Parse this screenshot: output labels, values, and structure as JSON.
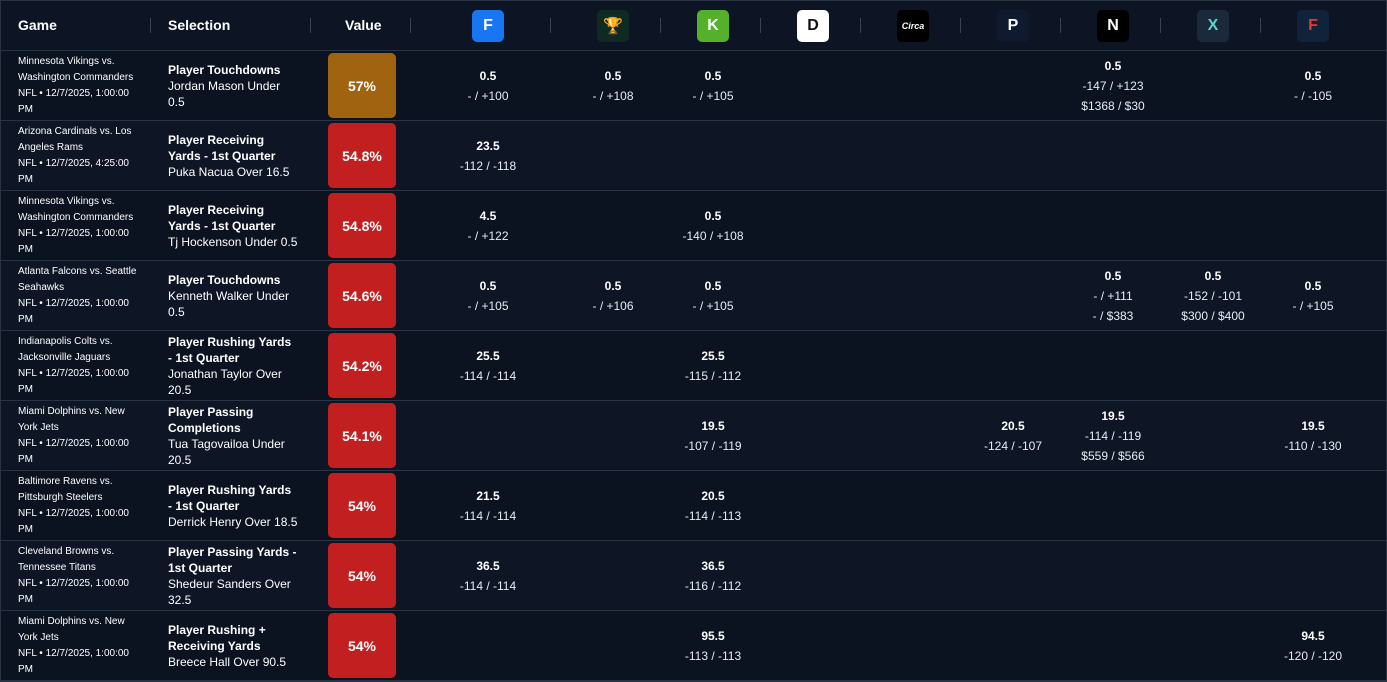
{
  "columns": {
    "game": "Game",
    "selection": "Selection",
    "value": "Value"
  },
  "books": [
    {
      "icon": "fanduel-icon",
      "glyph": "F",
      "bg": "#1876f2",
      "fg": "#ffffff"
    },
    {
      "icon": "trophy-icon",
      "glyph": "🏆",
      "bg": "#0f2a22",
      "fg": "#d9c58a"
    },
    {
      "icon": "draftkings-icon",
      "glyph": "K",
      "bg": "#53b12b",
      "fg": "#ffffff"
    },
    {
      "icon": "dabble-icon",
      "glyph": "D",
      "bg": "#ffffff",
      "fg": "#111111"
    },
    {
      "icon": "circa-icon",
      "glyph": "Circa",
      "bg": "#000000",
      "fg": "#ffffff"
    },
    {
      "icon": "prizepicks-icon",
      "glyph": "P",
      "bg": "#0f1a2e",
      "fg": "#ffffff"
    },
    {
      "icon": "novig-icon",
      "glyph": "N",
      "bg": "#000000",
      "fg": "#ffffff"
    },
    {
      "icon": "prophetx-icon",
      "glyph": "X",
      "bg": "#1b2a3a",
      "fg": "#5fd3c9"
    },
    {
      "icon": "fliff-icon",
      "glyph": "F",
      "bg": "#11233a",
      "fg": "#e53935"
    }
  ],
  "colors": {
    "value_high": "#a06410",
    "value_mid": "#c22020"
  },
  "rows": [
    {
      "game": "Minnesota Vikings vs. Washington Commanders",
      "meta": "NFL • 12/7/2025, 1:00:00 PM",
      "market": "Player Touchdowns",
      "pick": "Jordan Mason Under 0.5",
      "value": "57%",
      "tone": "high",
      "odds": [
        {
          "book": 0,
          "line": "0.5",
          "price": "- / +100"
        },
        {
          "book": 1,
          "line": "0.5",
          "price": "- / +108"
        },
        {
          "book": 2,
          "line": "0.5",
          "price": "- / +105"
        },
        {
          "book": 6,
          "line": "0.5",
          "price": "-147 / +123",
          "limit": "$1368 / $30"
        },
        {
          "book": 8,
          "line": "0.5",
          "price": "- / -105"
        }
      ]
    },
    {
      "game": "Arizona Cardinals vs. Los Angeles Rams",
      "meta": "NFL • 12/7/2025, 4:25:00 PM",
      "market": "Player Receiving Yards - 1st Quarter",
      "pick": "Puka Nacua Over 16.5",
      "value": "54.8%",
      "tone": "mid",
      "odds": [
        {
          "book": 0,
          "line": "23.5",
          "price": "-112 / -118"
        }
      ]
    },
    {
      "game": "Minnesota Vikings vs. Washington Commanders",
      "meta": "NFL • 12/7/2025, 1:00:00 PM",
      "market": "Player Receiving Yards - 1st Quarter",
      "pick": "Tj Hockenson Under 0.5",
      "value": "54.8%",
      "tone": "mid",
      "odds": [
        {
          "book": 0,
          "line": "4.5",
          "price": "- / +122"
        },
        {
          "book": 2,
          "line": "0.5",
          "price": "-140 / +108"
        }
      ]
    },
    {
      "game": "Atlanta Falcons vs. Seattle Seahawks",
      "meta": "NFL • 12/7/2025, 1:00:00 PM",
      "market": "Player Touchdowns",
      "pick": "Kenneth Walker Under 0.5",
      "value": "54.6%",
      "tone": "mid",
      "odds": [
        {
          "book": 0,
          "line": "0.5",
          "price": "- / +105"
        },
        {
          "book": 1,
          "line": "0.5",
          "price": "- / +106"
        },
        {
          "book": 2,
          "line": "0.5",
          "price": "- / +105"
        },
        {
          "book": 6,
          "line": "0.5",
          "price": "- / +111",
          "limit": "- / $383"
        },
        {
          "book": 7,
          "line": "0.5",
          "price": "-152 / -101",
          "limit": "$300 / $400"
        },
        {
          "book": 8,
          "line": "0.5",
          "price": "- / +105"
        }
      ]
    },
    {
      "game": "Indianapolis Colts vs. Jacksonville Jaguars",
      "meta": "NFL • 12/7/2025, 1:00:00 PM",
      "market": "Player Rushing Yards - 1st Quarter",
      "pick": "Jonathan Taylor Over 20.5",
      "value": "54.2%",
      "tone": "mid",
      "odds": [
        {
          "book": 0,
          "line": "25.5",
          "price": "-114 / -114"
        },
        {
          "book": 2,
          "line": "25.5",
          "price": "-115 / -112"
        }
      ]
    },
    {
      "game": "Miami Dolphins vs. New York Jets",
      "meta": "NFL • 12/7/2025, 1:00:00 PM",
      "market": "Player Passing Completions",
      "pick": "Tua Tagovailoa Under 20.5",
      "value": "54.1%",
      "tone": "mid",
      "odds": [
        {
          "book": 2,
          "line": "19.5",
          "price": "-107 / -119"
        },
        {
          "book": 5,
          "line": "20.5",
          "price": "-124 / -107"
        },
        {
          "book": 6,
          "line": "19.5",
          "price": "-114 / -119",
          "limit": "$559 / $566"
        },
        {
          "book": 8,
          "line": "19.5",
          "price": "-110 / -130"
        }
      ]
    },
    {
      "game": "Baltimore Ravens vs. Pittsburgh Steelers",
      "meta": "NFL • 12/7/2025, 1:00:00 PM",
      "market": "Player Rushing Yards - 1st Quarter",
      "pick": "Derrick Henry Over 18.5",
      "value": "54%",
      "tone": "mid",
      "odds": [
        {
          "book": 0,
          "line": "21.5",
          "price": "-114 / -114"
        },
        {
          "book": 2,
          "line": "20.5",
          "price": "-114 / -113"
        }
      ]
    },
    {
      "game": "Cleveland Browns vs. Tennessee Titans",
      "meta": "NFL • 12/7/2025, 1:00:00 PM",
      "market": "Player Passing Yards - 1st Quarter",
      "pick": "Shedeur Sanders Over 32.5",
      "value": "54%",
      "tone": "mid",
      "odds": [
        {
          "book": 0,
          "line": "36.5",
          "price": "-114 / -114"
        },
        {
          "book": 2,
          "line": "36.5",
          "price": "-116 / -112"
        }
      ]
    },
    {
      "game": "Miami Dolphins vs. New York Jets",
      "meta": "NFL • 12/7/2025, 1:00:00 PM",
      "market": "Player Rushing + Receiving Yards",
      "pick": "Breece Hall Over 90.5",
      "value": "54%",
      "tone": "mid",
      "odds": [
        {
          "book": 2,
          "line": "95.5",
          "price": "-113 / -113"
        },
        {
          "book": 8,
          "line": "94.5",
          "price": "-120 / -120"
        }
      ]
    }
  ]
}
